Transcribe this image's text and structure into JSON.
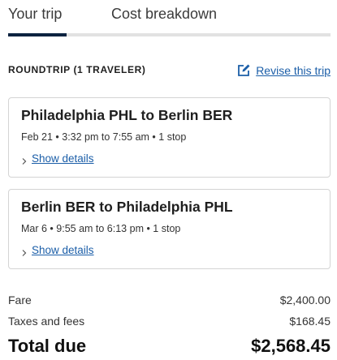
{
  "tabs": [
    {
      "label": "Your trip",
      "active": true
    },
    {
      "label": "Cost breakdown",
      "active": false
    }
  ],
  "trip": {
    "heading": "ROUNDTRIP (1 TRAVELER)",
    "revise_label": "Revise this trip",
    "revise_icon": "edit-icon"
  },
  "flights": [
    {
      "route": "Philadelphia PHL to Berlin BER",
      "schedule": "Feb 21 • 3:32 pm to 7:55 am • 1 stop",
      "details_label": "Show details"
    },
    {
      "route": "Berlin BER to Philadelphia PHL",
      "schedule": "Mar 6 • 9:55 am to 6:13 pm • 1 stop",
      "details_label": "Show details"
    }
  ],
  "pricing": {
    "fare_label": "Fare",
    "fare_value": "$2,400.00",
    "taxes_label": "Taxes and fees",
    "taxes_value": "$168.45",
    "total_label": "Total due",
    "total_value": "$2,568.45"
  },
  "colors": {
    "tab_active": "#0c2340",
    "link": "#1b5ea8"
  }
}
